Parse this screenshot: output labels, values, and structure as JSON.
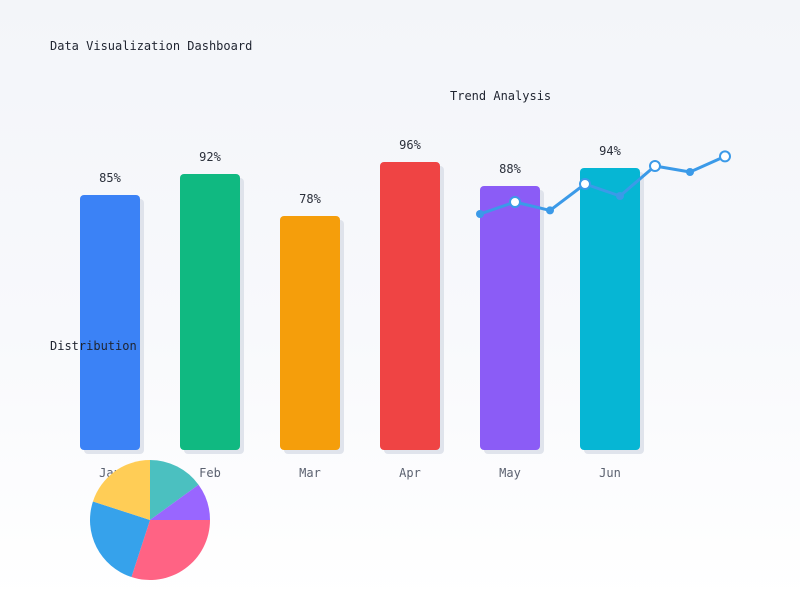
{
  "title": "Data Visualization Dashboard",
  "colors": {
    "background": "#f6f8fb",
    "shadow": "#d7dce6",
    "line": "#3b9ae8",
    "marker_fill": "#ffffff"
  },
  "chart_data": [
    {
      "type": "bar",
      "categories": [
        "Jan",
        "Feb",
        "Mar",
        "Apr",
        "May",
        "Jun"
      ],
      "values": [
        85,
        92,
        78,
        96,
        88,
        94
      ],
      "value_labels": [
        "85%",
        "92%",
        "78%",
        "96%",
        "88%",
        "94%"
      ],
      "colors": [
        "#3b82f6",
        "#10b981",
        "#f59e0b",
        "#ef4444",
        "#8b5cf6",
        "#06b6d4"
      ],
      "ylim": [
        0,
        100
      ],
      "grid": false,
      "legend": "none"
    },
    {
      "type": "line",
      "title": "Trend Analysis",
      "values": [
        30,
        40,
        33,
        55,
        45,
        70,
        65,
        78
      ],
      "ylim": [
        0,
        100
      ],
      "markers": "circle",
      "color": "#3b9ae8"
    },
    {
      "type": "pie",
      "title": "Distribution",
      "values": [
        15,
        10,
        30,
        25,
        20
      ],
      "colors": [
        "#4bc0c0",
        "#9966ff",
        "#ff6384",
        "#36a2eb",
        "#ffcd56"
      ]
    }
  ]
}
